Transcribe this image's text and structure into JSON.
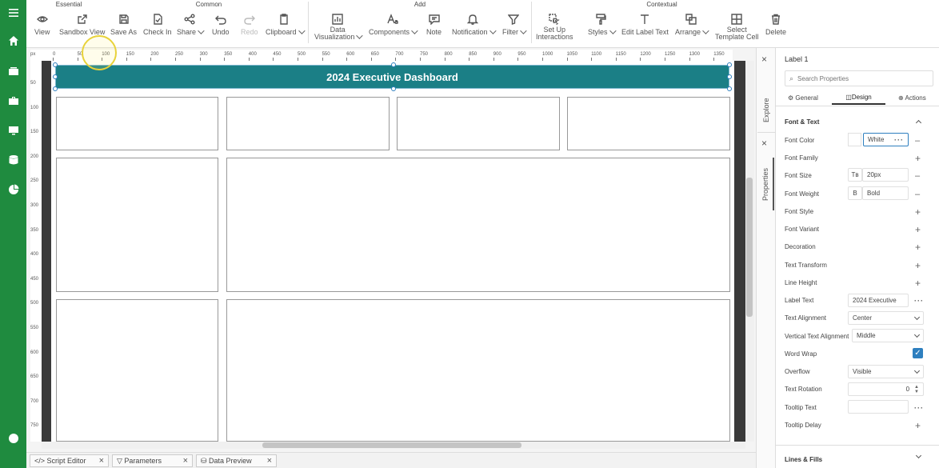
{
  "toolbar": {
    "groups": {
      "essential": "Essential",
      "common": "Common",
      "add": "Add",
      "contextual": "Contextual"
    },
    "buttons": {
      "view": "View",
      "sandbox_view": "Sandbox View",
      "save_as": "Save As",
      "check_in": "Check In",
      "share": "Share",
      "undo": "Undo",
      "redo": "Redo",
      "clipboard": "Clipboard",
      "data_viz_1": "Data",
      "data_viz_2": "Visualization",
      "components": "Components",
      "note": "Note",
      "notification": "Notification",
      "filter": "Filter",
      "interactions_1": "Set Up",
      "interactions_2": "Interactions",
      "styles": "Styles",
      "edit_label_text": "Edit Label Text",
      "arrange": "Arrange",
      "select_cell_1": "Select",
      "select_cell_2": "Template Cell",
      "delete": "Delete"
    }
  },
  "ruler": {
    "unit": "px",
    "h": [
      "0",
      "50",
      "100",
      "150",
      "200",
      "250",
      "300",
      "350",
      "400",
      "450",
      "500",
      "550",
      "600",
      "650",
      "700",
      "750",
      "800",
      "850",
      "900",
      "950",
      "1000",
      "1050",
      "1100",
      "1150",
      "1200",
      "1250",
      "1300",
      "1350"
    ],
    "v": [
      "50",
      "100",
      "150",
      "200",
      "250",
      "300",
      "350",
      "400",
      "450",
      "500",
      "550",
      "600",
      "650",
      "700",
      "750"
    ]
  },
  "canvas": {
    "header_title": "2024 Executive Dashboard"
  },
  "bottom_tabs": {
    "script_editor": "Script Editor",
    "parameters": "Parameters",
    "data_preview": "Data Preview"
  },
  "side_tabs": {
    "explore": "Explore",
    "properties": "Properties"
  },
  "panel": {
    "title": "Label 1",
    "search_placeholder": "Search Properties",
    "tabs": {
      "general": "General",
      "design": "Design",
      "actions": "Actions"
    },
    "section_font": "Font & Text",
    "rows": {
      "font_color": "Font Color",
      "font_family": "Font Family",
      "font_size": "Font Size",
      "font_weight": "Font Weight",
      "font_style": "Font Style",
      "font_variant": "Font Variant",
      "decoration": "Decoration",
      "text_transform": "Text Transform",
      "line_height": "Line Height",
      "label_text": "Label Text",
      "text_alignment": "Text Alignment",
      "vertical_alignment": "Vertical Text Alignment",
      "word_wrap": "Word Wrap",
      "overflow": "Overflow",
      "text_rotation": "Text Rotation",
      "tooltip_text": "Tooltip Text",
      "tooltip_delay": "Tooltip Delay"
    },
    "values": {
      "font_color": "White",
      "font_size": "20px",
      "font_size_prefix": "Tʙ",
      "font_weight": "Bold",
      "font_weight_prefix": "B",
      "label_text": "2024 Executive",
      "text_alignment": "Center",
      "vertical_alignment": "Middle",
      "overflow": "Visible",
      "text_rotation": "0"
    },
    "section_lines": "Lines & Fills"
  },
  "colors": {
    "nav": "#1f8b3f",
    "header": "#1b7f86",
    "accent": "#2e7fbf"
  }
}
